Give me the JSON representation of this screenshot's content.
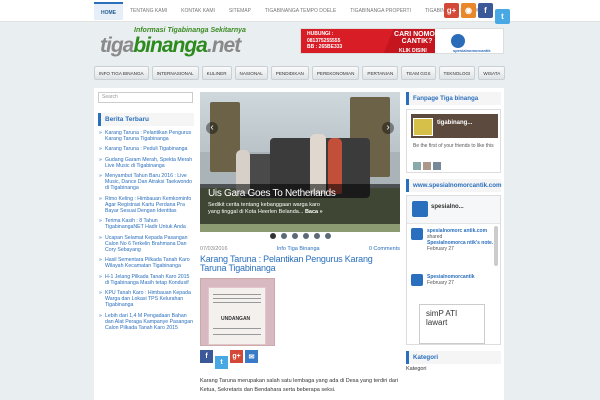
{
  "topnav": {
    "items": [
      "HOME",
      "TENTANG KAMI",
      "KONTAK KAMI",
      "SITEMAP",
      "TIGABINANGA TEMPO DOELE",
      "TIGABINANGA PROPERTI",
      "TIGABINANGA SPANDUK"
    ]
  },
  "header": {
    "tagline": "Informasi Tigabinanga Sekitarnya",
    "logo": "tigabinanga.net",
    "logo_part1": "tiga",
    "logo_part2": "binanga",
    "logo_part3": ".net"
  },
  "banner": {
    "hubungi": "HUBUNGI :",
    "phone1": "081375255555",
    "phone2": "BB : 265BE333",
    "cari": "CARI NOMOR CANTIK?",
    "klik": "KLIK DISINI",
    "brand": "spesialnomorcantik"
  },
  "catnav": {
    "items": [
      "INFO TIGA BINANGA",
      "INTERNASIONAL",
      "KULINER",
      "NASIONAL",
      "PENDIDIKAN",
      "PEREKONOMIAN",
      "PERTANIAN",
      "TEAM GGS",
      "TEKNOLOGI",
      "WISATA"
    ]
  },
  "sidebar": {
    "search_placeholder": "Search",
    "title": "Berita Terbaru",
    "items": [
      "Karang Taruna : Pelantikan Pengurus Karang Taruna Tigabinanga",
      "Karang Taruna : Peduli Tigabinanga",
      "Gudang Garam Merah, Spekta Merah Live Music di Tigabinanga",
      "Menyambut Tahun Baru 2016 : Live Music, Dance Dan Atraksi Taekwondo di Tigabinanga",
      "Rimo Keling : Himbauan Kemkominfo Agar Registrasi Kartu Perdana Pra Bayar Sesuai Dengan Identitas",
      "Terima Kasih : 8 Tahun TigabinangaNET Hadir Untuk Anda",
      "Ucapan Selamat Kepada Pasangan Calon No 6 Terkelin Brahmana Dan Cory Sebayang",
      "Hasil Sementara Pilkada Tanah Karo Wilayah Kecamatan Tigabinanga",
      "H-1 Jelang Pilkada Tanah Karo 2015 di Tigabinanga Masih tetap Kondusif",
      "KPU Tanah Karo : Himbauan Kepada Warga dan Lokasi TPS Kelurahan Tigabinanga",
      "Lebih dari 1,4 M Pengadaan Bahan dan Alat Peraga Kampanye Pasangan Calon Pilkada Tanah Karo 2015"
    ]
  },
  "slider": {
    "title": "Uis Gara Goes To Netherlands",
    "excerpt": "Sedikit cerita tentang kebanggaan warga karo yang tinggal di Kota Heerlen Belanda...",
    "more": "Baca »",
    "prev": "‹",
    "next": "›"
  },
  "post": {
    "date": "07/03/2016",
    "category": "Info Tiga Binanga",
    "comments": "0 Comments",
    "title": "Karang Taruna : Pelantikan Pengurus Karang Taruna Tigabinanga",
    "image_text": "UNDANGAN",
    "body": "Karang Taruna merupakan salah satu lembaga yang ada di Desa yang terdiri dari Ketua, Sekretaris dan Bendahara serta beberapa seksi."
  },
  "right": {
    "fanpage_title": "Fanpage Tiga binanga",
    "fb_name": "tigabinang...",
    "fb_text": "Be the first of your friends to like this",
    "site_title": "www.spesialnomorcantik.com",
    "tw_name": "spesialno...",
    "tw1_user": "spesialnomorc antik.com",
    "tw1_action": "shared",
    "tw1_text": "Spesialnomorca ntik's note.",
    "tw1_time": "February 27",
    "tw2_user": "Spesialnomorcantik",
    "tw2_time": "February 27",
    "quote": "simP ATI lawart",
    "kategori_title": "Kategori",
    "kategori_label": "Kategori"
  }
}
